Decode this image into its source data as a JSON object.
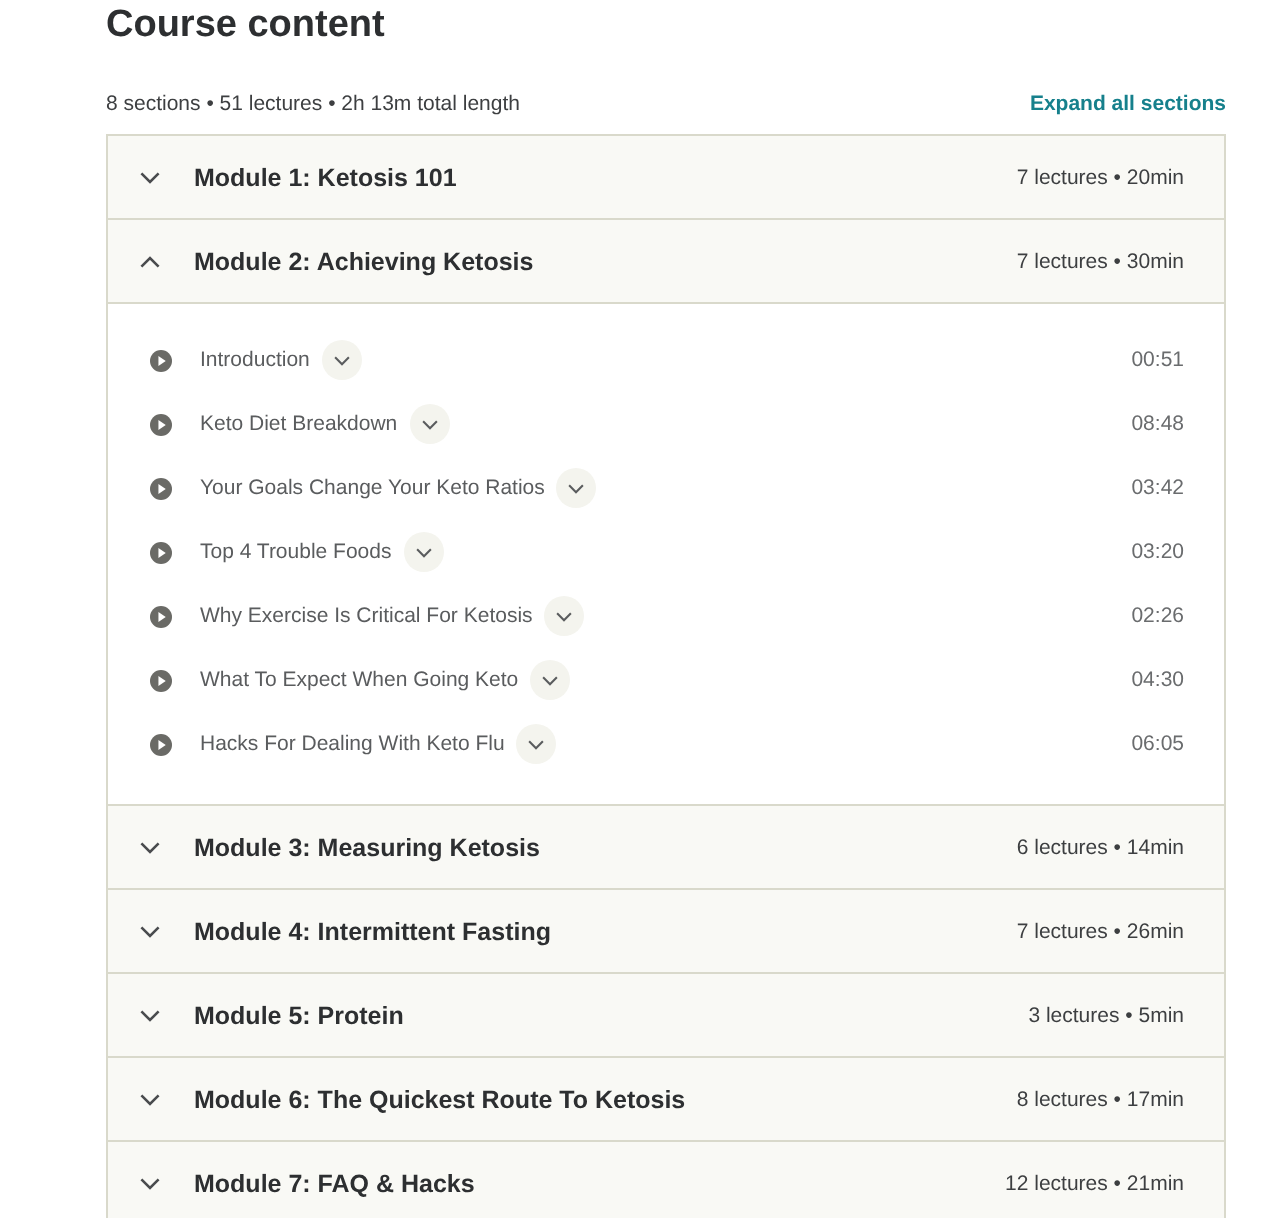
{
  "heading": "Course content",
  "summary": "8 sections • 51 lectures • 2h 13m total length",
  "expand_all": "Expand all sections",
  "sections": [
    {
      "title": "Module 1: Ketosis 101",
      "meta": "7 lectures • 20min",
      "expanded": false
    },
    {
      "title": "Module 2: Achieving Ketosis",
      "meta": "7 lectures • 30min",
      "expanded": true,
      "lectures": [
        {
          "title": "Introduction",
          "duration": "00:51"
        },
        {
          "title": "Keto Diet Breakdown",
          "duration": "08:48"
        },
        {
          "title": "Your Goals Change Your Keto Ratios",
          "duration": "03:42"
        },
        {
          "title": "Top 4 Trouble Foods",
          "duration": "03:20"
        },
        {
          "title": "Why Exercise Is Critical For Ketosis",
          "duration": "02:26"
        },
        {
          "title": "What To Expect When Going Keto",
          "duration": "04:30"
        },
        {
          "title": "Hacks For Dealing With Keto Flu",
          "duration": "06:05"
        }
      ]
    },
    {
      "title": "Module 3: Measuring Ketosis",
      "meta": "6 lectures • 14min",
      "expanded": false
    },
    {
      "title": "Module 4: Intermittent Fasting",
      "meta": "7 lectures • 26min",
      "expanded": false
    },
    {
      "title": "Module 5: Protein",
      "meta": "3 lectures • 5min",
      "expanded": false
    },
    {
      "title": "Module 6: The Quickest Route To Ketosis",
      "meta": "8 lectures • 17min",
      "expanded": false
    },
    {
      "title": "Module 7: FAQ & Hacks",
      "meta": "12 lectures • 21min",
      "expanded": false
    }
  ]
}
